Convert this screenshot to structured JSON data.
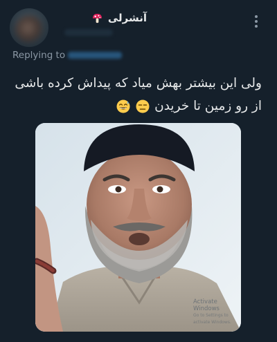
{
  "tweet": {
    "display_name": "آنشرلی",
    "display_name_emoji": "mushroom-icon",
    "replying_to_label": "Replying to",
    "text_line_1": "ولی این بیشتر بهش میاد که پیداش کرده باشی",
    "text_line_2": "از رو زمین تا خریدن",
    "text_line_2_emojis": [
      "unamused-face-icon",
      "grinning-sweat-face-icon"
    ],
    "more_menu_icon": "more-vertical-icon"
  },
  "media": {
    "description_icon": "photo-icon",
    "watermark_title": "Activate Windows",
    "watermark_subtitle": "Go to Settings to activate Windows."
  },
  "colors": {
    "background": "#15202b",
    "text_primary": "#e7e9ea",
    "text_secondary": "#8b98a5",
    "link": "#1d9bf0"
  }
}
